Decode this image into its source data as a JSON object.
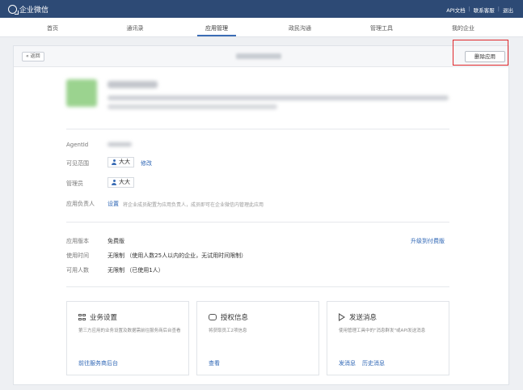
{
  "topbar": {
    "brand": "企业微信",
    "links": [
      "API文档",
      "联系客服",
      "退出"
    ],
    "separator": "|"
  },
  "nav": {
    "items": [
      {
        "label": "首页"
      },
      {
        "label": "通讯录"
      },
      {
        "label": "应用管理"
      },
      {
        "label": "政民沟通"
      },
      {
        "label": "管理工具"
      },
      {
        "label": "我的企业"
      }
    ],
    "active": "应用管理"
  },
  "header": {
    "back_label": "« 返回",
    "delete_label": "删除应用"
  },
  "info": {
    "agentid_label": "AgentId",
    "visible_label": "可见范围",
    "visible_chip": "大大",
    "visible_edit": "修改",
    "admin_label": "管理员",
    "admin_chip": "大大",
    "owner_label": "应用负责人",
    "owner_link": "设置",
    "owner_hint": "将企业成员配置为应用负责人，成员即可在企业微信内管理此应用"
  },
  "plan": {
    "version_label": "应用版本",
    "version_value": "免费版",
    "upgrade_link": "升级到付费版",
    "time_label": "使用时间",
    "time_value": "无限制 （使用人数25人以内的企业，无试用时间限制）",
    "users_label": "可用人数",
    "users_value": "无限制 （已使用1人）"
  },
  "panels": [
    {
      "icon": "grid-icon",
      "title": "业务设置",
      "desc": "第三方应用的业务设置及数据需前往服务商后台查看",
      "links": [
        "前往服务商后台"
      ]
    },
    {
      "icon": "chat-icon",
      "title": "授权信息",
      "desc": "将获取员工2项信息",
      "links": [
        "查看"
      ]
    },
    {
      "icon": "send-icon",
      "title": "发送消息",
      "desc": "使用管理工具中的\"消息群发\"或API发送消息",
      "links": [
        "发消息",
        "历史消息"
      ]
    }
  ],
  "colors": {
    "topbar": "#2d4a75",
    "link": "#2e66b5",
    "highlight": "#e0282c"
  }
}
